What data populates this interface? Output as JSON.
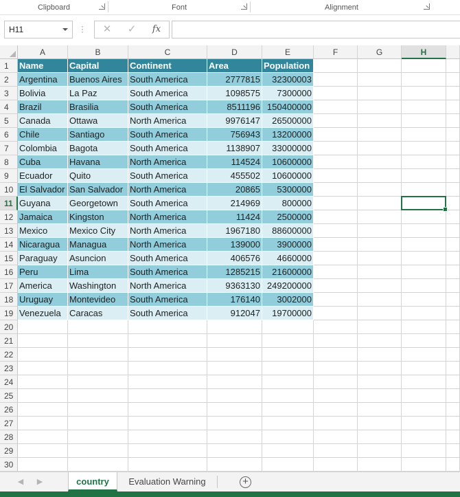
{
  "ribbon": {
    "groups": [
      "Clipboard",
      "Font",
      "Alignment"
    ]
  },
  "formula_bar": {
    "name_box": "H11",
    "formula": "",
    "cancel_icon": "x-icon",
    "enter_icon": "check-icon",
    "fx_label": "fx"
  },
  "sheet": {
    "columns": [
      "A",
      "B",
      "C",
      "D",
      "E",
      "F",
      "G",
      "H"
    ],
    "selected_column": "H",
    "rows": [
      "1",
      "2",
      "3",
      "4",
      "5",
      "6",
      "7",
      "8",
      "9",
      "10",
      "11",
      "12",
      "13",
      "14",
      "15",
      "16",
      "17",
      "18",
      "19",
      "20",
      "21",
      "22",
      "23",
      "24",
      "25",
      "26",
      "27",
      "28",
      "29",
      "30"
    ],
    "selected_row": "11",
    "active_cell": "H11",
    "table_header": [
      "Name",
      "Capital",
      "Continent",
      "Area",
      "Population"
    ],
    "table_rows": [
      [
        "Argentina",
        "Buenos Aires",
        "South America",
        "2777815",
        "32300003"
      ],
      [
        "Bolivia",
        "La Paz",
        "South America",
        "1098575",
        "7300000"
      ],
      [
        "Brazil",
        "Brasilia",
        "South America",
        "8511196",
        "150400000"
      ],
      [
        "Canada",
        "Ottawa",
        "North America",
        "9976147",
        "26500000"
      ],
      [
        "Chile",
        "Santiago",
        "South America",
        "756943",
        "13200000"
      ],
      [
        "Colombia",
        "Bagota",
        "South America",
        "1138907",
        "33000000"
      ],
      [
        "Cuba",
        "Havana",
        "North America",
        "114524",
        "10600000"
      ],
      [
        "Ecuador",
        "Quito",
        "South America",
        "455502",
        "10600000"
      ],
      [
        "El Salvador",
        "San Salvador",
        "North America",
        "20865",
        "5300000"
      ],
      [
        "Guyana",
        "Georgetown",
        "South America",
        "214969",
        "800000"
      ],
      [
        "Jamaica",
        "Kingston",
        "North America",
        "11424",
        "2500000"
      ],
      [
        "Mexico",
        "Mexico City",
        "North America",
        "1967180",
        "88600000"
      ],
      [
        "Nicaragua",
        "Managua",
        "North America",
        "139000",
        "3900000"
      ],
      [
        "Paraguay",
        "Asuncion",
        "South America",
        "406576",
        "4660000"
      ],
      [
        "Peru",
        "Lima",
        "South America",
        "1285215",
        "21600000"
      ],
      [
        "America",
        "Washington",
        "North America",
        "9363130",
        "249200000"
      ],
      [
        "Uruguay",
        "Montevideo",
        "South America",
        "176140",
        "3002000"
      ],
      [
        "Venezuela",
        "Caracas",
        "South America",
        "912047",
        "19700000"
      ]
    ],
    "colors": {
      "header_fill": "#31869b",
      "band_dark": "#92cddc",
      "band_light": "#daeef3",
      "accent": "#217346"
    }
  },
  "tabs": {
    "items": [
      "country",
      "Evaluation Warning"
    ],
    "active": "country",
    "add_icon": "plus-circle-icon",
    "prev_icon": "chevron-left-icon",
    "next_icon": "chevron-right-icon"
  }
}
